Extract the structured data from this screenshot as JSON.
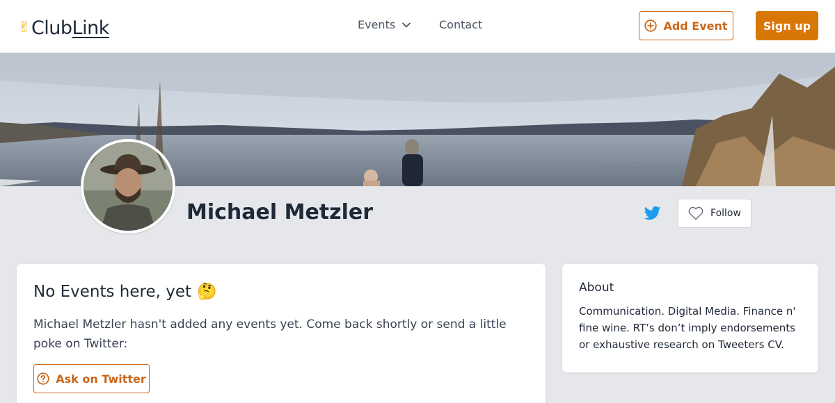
{
  "header": {
    "logo_prefix": "Club",
    "logo_suffix": "Link",
    "logo_icon": "victory-hand-icon",
    "nav": {
      "events_label": "Events",
      "contact_label": "Contact"
    },
    "add_event_label": "Add Event",
    "signup_label": "Sign up"
  },
  "profile": {
    "name": "Michael Metzler",
    "follow_label": "Follow",
    "social_icon": "twitter-icon"
  },
  "events_card": {
    "title": "No Events here, yet",
    "title_emoji": "🤔",
    "description": "Michael Metzler hasn't added any events yet. Come back shortly or send a little poke on Twitter:",
    "ask_button_label": "Ask on Twitter"
  },
  "about_card": {
    "title": "About",
    "text": "Communication. Digital Media. Finance n' fine wine. RT’s don’t imply endorsements or exhaustive research on Tweeters CV."
  },
  "colors": {
    "accent": "#d97706",
    "accent_outline": "#c9671a",
    "twitter": "#1d9bf0",
    "page_bg": "#e5e7eb"
  }
}
